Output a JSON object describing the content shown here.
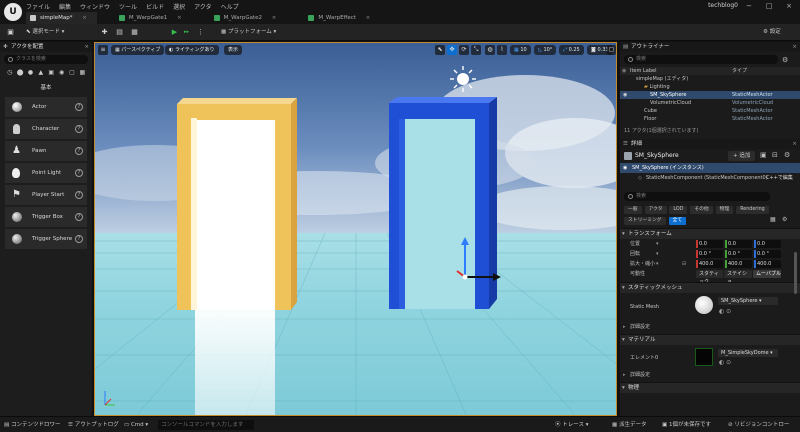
{
  "titlebar": {
    "logo": "U",
    "menu": [
      "ファイル",
      "編集",
      "ウィンドウ",
      "ツール",
      "ビルド",
      "選択",
      "アクタ",
      "ヘルプ"
    ],
    "tabs": [
      {
        "label": "simpleMap*",
        "close": "×"
      },
      {
        "label": "M_WarpGate1",
        "close": "×"
      },
      {
        "label": "M_WarpGate2",
        "close": "×"
      },
      {
        "label": "M_WarpEffect",
        "close": "×"
      }
    ],
    "project_name": "techblog0",
    "minimize": "−",
    "maximize": "□",
    "close": "×"
  },
  "toolbar": {
    "select_mode": "選択モード",
    "platform": "プラットフォーム",
    "settings": "設定"
  },
  "place_actors": {
    "title": "アクタを配置",
    "search_placeholder": "クラスを検索",
    "category": "基本",
    "items": [
      {
        "label": "Actor",
        "icon": "sphere-icon"
      },
      {
        "label": "Character",
        "icon": "character-icon"
      },
      {
        "label": "Pawn",
        "icon": "pawn-icon"
      },
      {
        "label": "Point Light",
        "icon": "light-bulb-icon"
      },
      {
        "label": "Player Start",
        "icon": "flag-icon"
      },
      {
        "label": "Trigger Box",
        "icon": "box-icon"
      },
      {
        "label": "Trigger Sphere",
        "icon": "sphere-icon"
      }
    ]
  },
  "viewport": {
    "perspective": "パースペクティブ",
    "lighting": "ライティングあり",
    "show": "表示",
    "grid_snap": "10",
    "rotation_snap": "10°",
    "scale_snap": "0.25",
    "camera_speed": "0.33"
  },
  "outliner": {
    "title": "アウトライナー",
    "search_placeholder": "検索",
    "col_label": "Item Label",
    "col_type": "タイプ",
    "rows": [
      {
        "label": "simpleMap (エディタ)",
        "type": "",
        "indent": 1
      },
      {
        "label": "Lighting",
        "type": "",
        "indent": 2
      },
      {
        "label": "SM_SkySphere",
        "type": "StaticMeshActor",
        "indent": 3,
        "selected": true
      },
      {
        "label": "VolumetricCloud",
        "type": "VolumetricCloud",
        "indent": 3
      },
      {
        "label": "Cube",
        "type": "StaticMeshActor",
        "indent": 2
      },
      {
        "label": "Floor",
        "type": "StaticMeshActor",
        "indent": 2
      }
    ],
    "count_text": "11 アクタ(1個選択されています)"
  },
  "details": {
    "title": "詳細",
    "actor_name": "SM_SkySphere",
    "add_button": "+ 追加",
    "instance_row": "SM_SkySphere (インスタンス)",
    "component_row": "StaticMeshComponent (StaticMeshComponent0)",
    "edit_cpp": "C++で編集",
    "search_placeholder": "検索",
    "filter_tabs": [
      "一般",
      "アクタ",
      "LOD",
      "その他",
      "物理",
      "Rendering",
      "ストリーミング",
      "全て"
    ],
    "transform_section": "トランスフォーム",
    "location_label": "位置",
    "rotation_label": "回転",
    "scale_label": "拡大・縮小",
    "location": [
      "0.0",
      "0.0",
      "0.0"
    ],
    "rotation": [
      "0.0 °",
      "0.0 °",
      "0.0 °"
    ],
    "scale": [
      "400.0",
      "400.0",
      "400.0"
    ],
    "mobility_label": "可動性",
    "mobility_options": [
      "スタティック",
      "ステイショ...",
      "ムーバブル"
    ],
    "static_mesh_section": "スタティックメッシュ",
    "static_mesh_label": "Static Mesh",
    "static_mesh_value": "SM_SkySphere",
    "advanced": "詳細設定",
    "materials_section": "マテリアル",
    "element_label": "エレメント0",
    "material_value": "M_SimpleSkyDome",
    "physics_section": "物理"
  },
  "statusbar": {
    "content_drawer": "コンテンツドロワー",
    "output_log": "アウトプットログ",
    "cmd": "Cmd",
    "console_placeholder": "コンソールコマンドを入力します",
    "trace": "トレース",
    "derived_data": "派生データ",
    "unsaved": "1個が未保存です",
    "revision_control": "リビジョンコントロール..."
  },
  "colors": {
    "gate_left": "#f0c25a",
    "gate_right": "#1f4fd4",
    "accent": "#0d6fd0"
  }
}
